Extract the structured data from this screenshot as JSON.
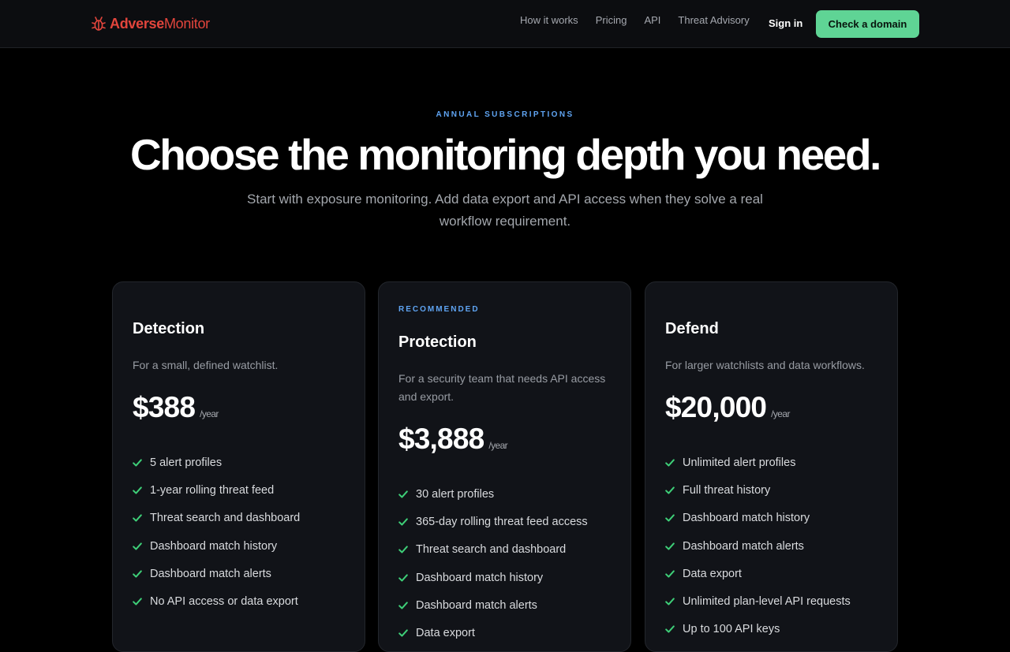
{
  "brand": {
    "name_part1": "Adverse",
    "name_part2": "Monitor"
  },
  "nav": {
    "links": [
      "How it works",
      "Pricing",
      "API",
      "Threat Advisory"
    ],
    "sign_in": "Sign in",
    "cta": "Check a domain"
  },
  "hero": {
    "eyebrow": "ANNUAL SUBSCRIPTIONS",
    "headline": "Choose the monitoring depth you need.",
    "subtitle": "Start with exposure monitoring. Add data export and API access when they solve a real workflow requirement."
  },
  "plans": [
    {
      "badge": "",
      "name": "Detection",
      "description": "For a small, defined watchlist.",
      "price": "$388",
      "period": "/year",
      "features": [
        "5 alert profiles",
        "1-year rolling threat feed",
        "Threat search and dashboard",
        "Dashboard match history",
        "Dashboard match alerts",
        "No API access or data export"
      ]
    },
    {
      "badge": "RECOMMENDED",
      "name": "Protection",
      "description": "For a security team that needs API access and export.",
      "price": "$3,888",
      "period": "/year",
      "features": [
        "30 alert profiles",
        "365-day rolling threat feed access",
        "Threat search and dashboard",
        "Dashboard match history",
        "Dashboard match alerts",
        "Data export"
      ]
    },
    {
      "badge": "",
      "name": "Defend",
      "description": "For larger watchlists and data workflows.",
      "price": "$20,000",
      "period": "/year",
      "features": [
        "Unlimited alert profiles",
        "Full threat history",
        "Dashboard match history",
        "Dashboard match alerts",
        "Data export",
        "Unlimited plan-level API requests",
        "Up to 100 API keys"
      ]
    }
  ],
  "colors": {
    "accent_green": "#5fd495",
    "accent_blue": "#5fa4f2",
    "brand_red": "#e2453c",
    "check_green": "#3ecf78"
  },
  "icons": {
    "logo": "bug-icon",
    "feature": "check-icon"
  }
}
